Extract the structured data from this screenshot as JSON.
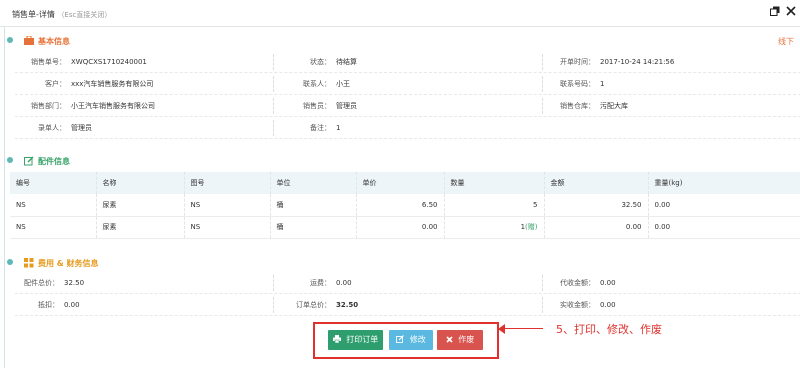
{
  "window": {
    "title": "销售单-详情",
    "hint": "（Esc直接关闭）",
    "maximize_icon": "maximize-icon",
    "close_icon": "close-icon"
  },
  "basic": {
    "section_title": "基本信息",
    "collapse_label": "线下",
    "order_no_label": "销售单号：",
    "order_no": "XWQCXS1710240001",
    "status_label": "状态：",
    "status": "待结算",
    "open_time_label": "开单时间：",
    "open_time": "2017-10-24 14:21:56",
    "customer_label": "客户：",
    "customer": "xxx汽车销售服务有限公司",
    "contact_label": "联系人：",
    "contact": "小王",
    "phone_label": "联系号码：",
    "phone": "1",
    "dept_label": "销售部门：",
    "dept": "小王汽车销售服务有限公司",
    "salesman_label": "销售员：",
    "salesman": "管理员",
    "warehouse_label": "销售仓库：",
    "warehouse": "污配大库",
    "recorder_label": "录单人：",
    "recorder": "管理员",
    "remark_label": "备注：",
    "remark": "1"
  },
  "parts": {
    "section_title": "配件信息",
    "headers": [
      "编号",
      "名称",
      "图号",
      "单位",
      "单价",
      "数量",
      "金额",
      "重量(kg)"
    ],
    "rows": [
      {
        "code": "NS",
        "name": "尿素",
        "drawing": "NS",
        "unit": "桶",
        "price": "6.50",
        "qty": "5",
        "qty_note": "",
        "amount": "32.50",
        "weight": "0.00"
      },
      {
        "code": "NS",
        "name": "尿素",
        "drawing": "NS",
        "unit": "桶",
        "price": "0.00",
        "qty": "1",
        "qty_note": "(赠)",
        "amount": "0.00",
        "weight": "0.00"
      }
    ]
  },
  "costs": {
    "section_title": "费用 & 财务信息",
    "parts_total_label": "配件总价：",
    "parts_total": "32.50",
    "freight_label": "运费：",
    "freight": "0.00",
    "collect_label": "代收金额：",
    "collect": "0.00",
    "discount_label": "抵扣：",
    "discount": "0.00",
    "order_total_label": "订单总价：",
    "order_total": "32.50",
    "received_label": "实收金额：",
    "received": "0.00"
  },
  "actions": {
    "print_label": "打印订单",
    "edit_label": "修改",
    "void_label": "作废"
  },
  "annotation": "5、打印、修改、作废",
  "colors": {
    "accent_orange": "#e6723a",
    "accent_green": "#3aa36a",
    "btn_print": "#2e9e6e",
    "btn_edit": "#5bb8e0",
    "btn_void": "#d9534f",
    "highlight_red": "#e0312d"
  }
}
